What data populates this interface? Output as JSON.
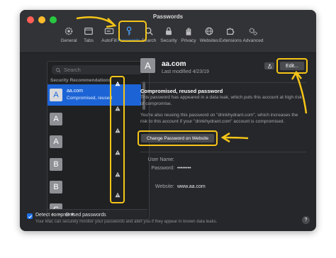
{
  "window": {
    "title": "Passwords"
  },
  "toolbar": {
    "tabs": [
      {
        "label": "General",
        "icon": "gear-icon"
      },
      {
        "label": "Tabs",
        "icon": "tabs-icon"
      },
      {
        "label": "AutoFill",
        "icon": "autofill-icon"
      },
      {
        "label": "Passwords",
        "icon": "key-icon",
        "active": true
      },
      {
        "label": "Search",
        "icon": "search-icon"
      },
      {
        "label": "Security",
        "icon": "lock-icon"
      },
      {
        "label": "Privacy",
        "icon": "hand-icon"
      },
      {
        "label": "Websites",
        "icon": "globe-icon"
      },
      {
        "label": "Extensions",
        "icon": "puzzle-icon"
      },
      {
        "label": "Advanced",
        "icon": "gears-icon"
      }
    ]
  },
  "sidebar": {
    "search_placeholder": "Search",
    "section_label": "Security Recommendations",
    "items": [
      {
        "avatar": "A",
        "title": "aa.com",
        "subtitle": "Compromised, reused",
        "selected": true
      },
      {
        "avatar": "A"
      },
      {
        "avatar": "A"
      },
      {
        "avatar": "B"
      },
      {
        "avatar": "B"
      },
      {
        "avatar": "C"
      }
    ],
    "footer": {
      "add": "+",
      "remove": "−",
      "more": "⊖ ▾"
    }
  },
  "detail": {
    "avatar": "A",
    "title": "aa.com",
    "modified": "Last modified 4/23/19",
    "edit_label": "Edit...",
    "warning_title": "Compromised, reused password",
    "warning_body": "This password has appeared in a data leak, which puts this account at high risk of compromise.",
    "warning_body2": "You're also reusing this password on \"drinkhydrant.com\", which increases the risk to this account if your \"drinkhydrant.com\" account is compromised.",
    "change_button": "Change Password on Website",
    "username_label": "User Name:",
    "username_value": "",
    "password_label": "Password:",
    "password_value": "••••••••",
    "website_label": "Website:",
    "website_value": "www.aa.com"
  },
  "bottom": {
    "checkbox_label": "Detect compromised passwords",
    "checkbox_checked": true,
    "help_text": "Your Mac can securely monitor your passwords and alert you if they appear in known data leaks.",
    "help_button": "?"
  },
  "colors": {
    "accent": "#1c64d6",
    "annotation": "#f5c518",
    "window_bg": "#26272a"
  }
}
